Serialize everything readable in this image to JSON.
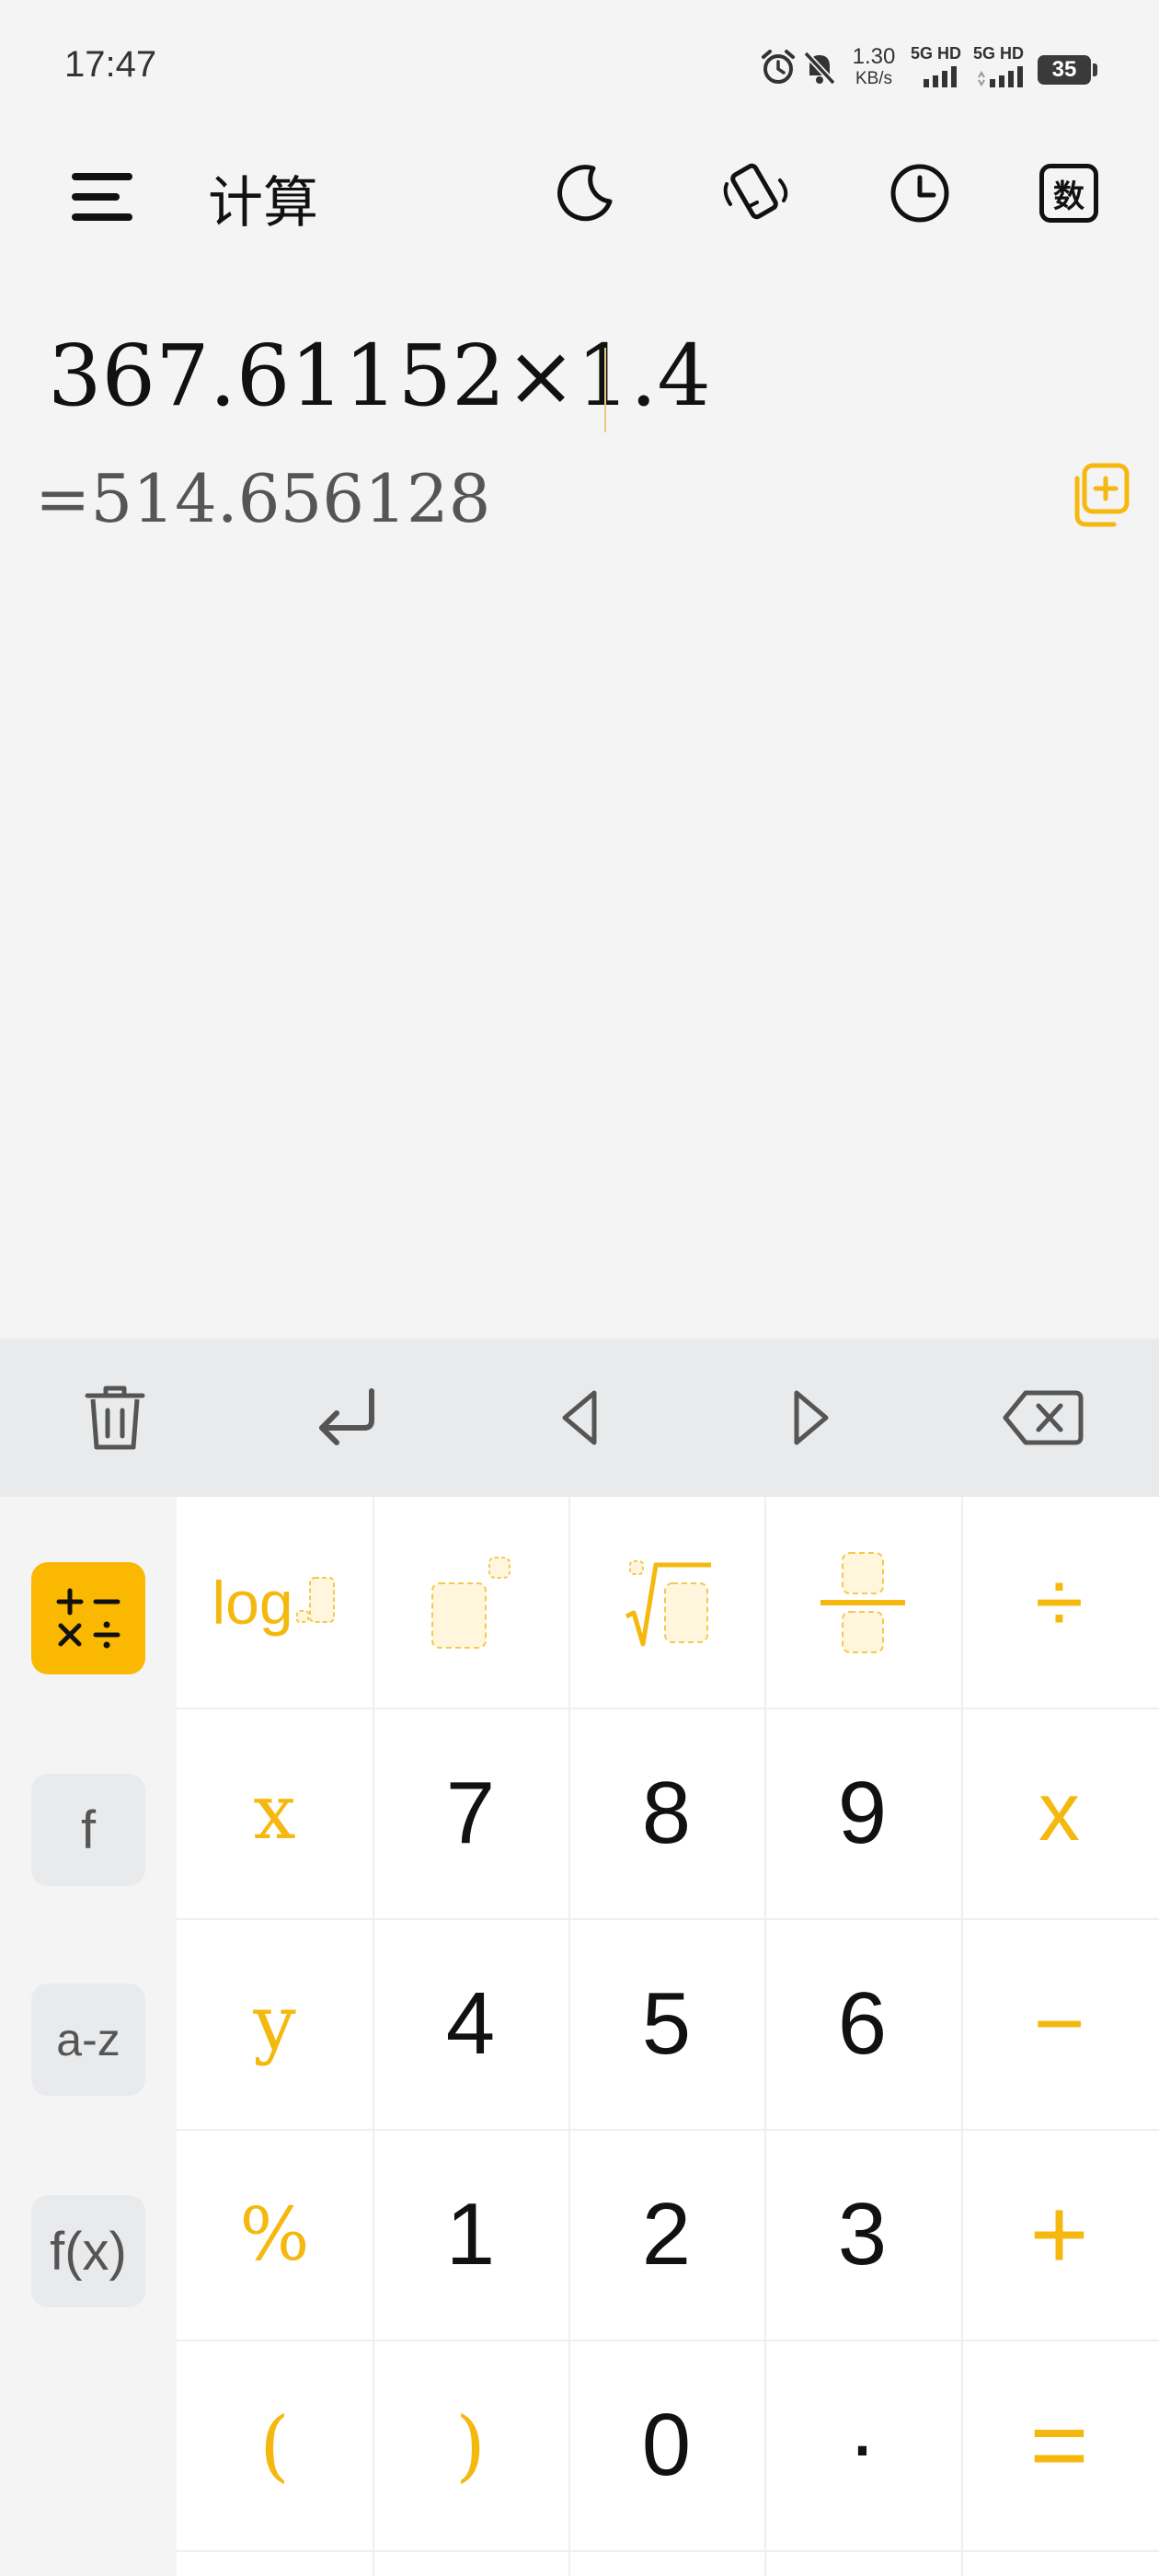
{
  "status_bar": {
    "time": "17:47",
    "net_speed": "1.30",
    "net_unit": "KB/s",
    "sim1_label": "5G HD",
    "sim2_label": "5G HD",
    "battery": "35",
    "icons": [
      "alarm-icon",
      "mute-icon",
      "signal-icon",
      "signal-icon",
      "battery-icon"
    ]
  },
  "header": {
    "title": "计算",
    "buttons": [
      "theme-icon",
      "rotate-icon",
      "history-icon",
      "number-mode-icon"
    ],
    "number_mode_label": "数"
  },
  "display": {
    "expression": "367.61152×1.4",
    "result": "=514.656128"
  },
  "toolbar": {
    "buttons": [
      "delete-all-icon",
      "enter-icon",
      "cursor-left-icon",
      "cursor-right-icon",
      "backspace-icon"
    ]
  },
  "side_modes": [
    {
      "label": "basic-operators",
      "active": true
    },
    {
      "label": "f",
      "active": false
    },
    {
      "label": "a-z",
      "active": false
    },
    {
      "label": "f(x)",
      "active": false
    }
  ],
  "keypad": {
    "log_label": "log",
    "rows": [
      [
        "x",
        "7",
        "8",
        "9",
        "x"
      ],
      [
        "y",
        "4",
        "5",
        "6",
        "−"
      ],
      [
        "%",
        "1",
        "2",
        "3",
        "+"
      ],
      [
        "(",
        ")",
        "0",
        "·",
        "="
      ]
    ],
    "divide": "÷"
  },
  "colors": {
    "accent": "#F5B80F",
    "background": "#F4F4F4",
    "toolbar": "#E9EAEC",
    "keypad": "#FFFFFF"
  }
}
